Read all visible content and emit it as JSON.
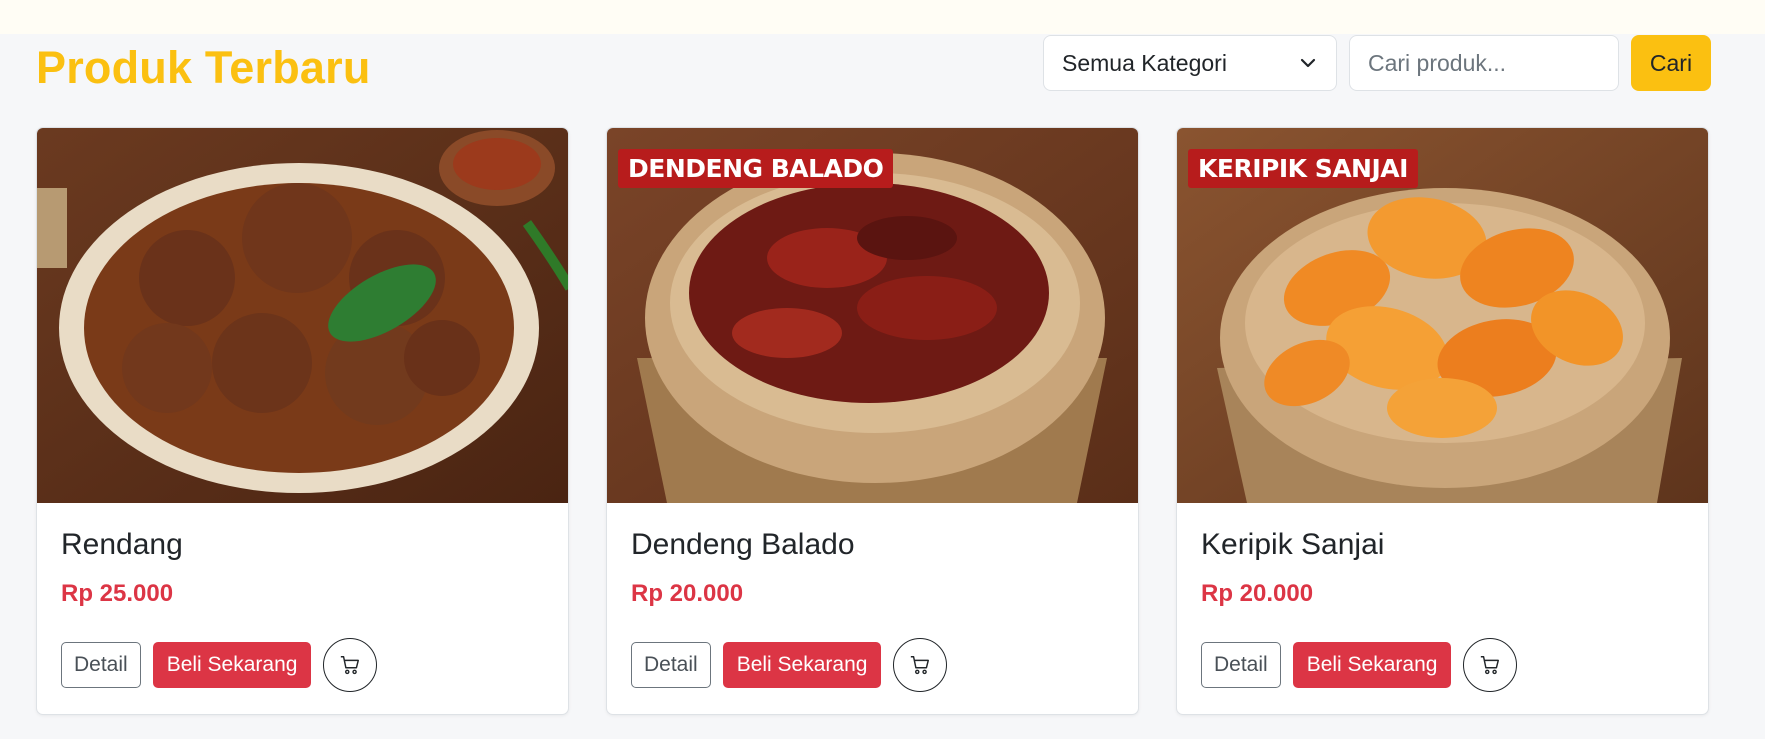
{
  "header": {
    "title": "Produk Terbaru",
    "category_selected": "Semua Kategori",
    "search_placeholder": "Cari produk...",
    "search_button": "Cari"
  },
  "products": [
    {
      "name": "Rendang",
      "price": "Rp 25.000",
      "image_label": "",
      "detail_label": "Detail",
      "buy_label": "Beli Sekarang"
    },
    {
      "name": "Dendeng Balado",
      "price": "Rp 20.000",
      "image_label": "DENDENG BALADO",
      "detail_label": "Detail",
      "buy_label": "Beli Sekarang"
    },
    {
      "name": "Keripik Sanjai",
      "price": "Rp 20.000",
      "image_label": "KERIPIK SANJAI",
      "detail_label": "Detail",
      "buy_label": "Beli Sekarang"
    }
  ],
  "colors": {
    "accent": "#fbc011",
    "price": "#dc3545",
    "label_bg": "#b71c1c"
  },
  "icons": {
    "select": "chevron-down-icon",
    "cart": "cart-icon"
  }
}
